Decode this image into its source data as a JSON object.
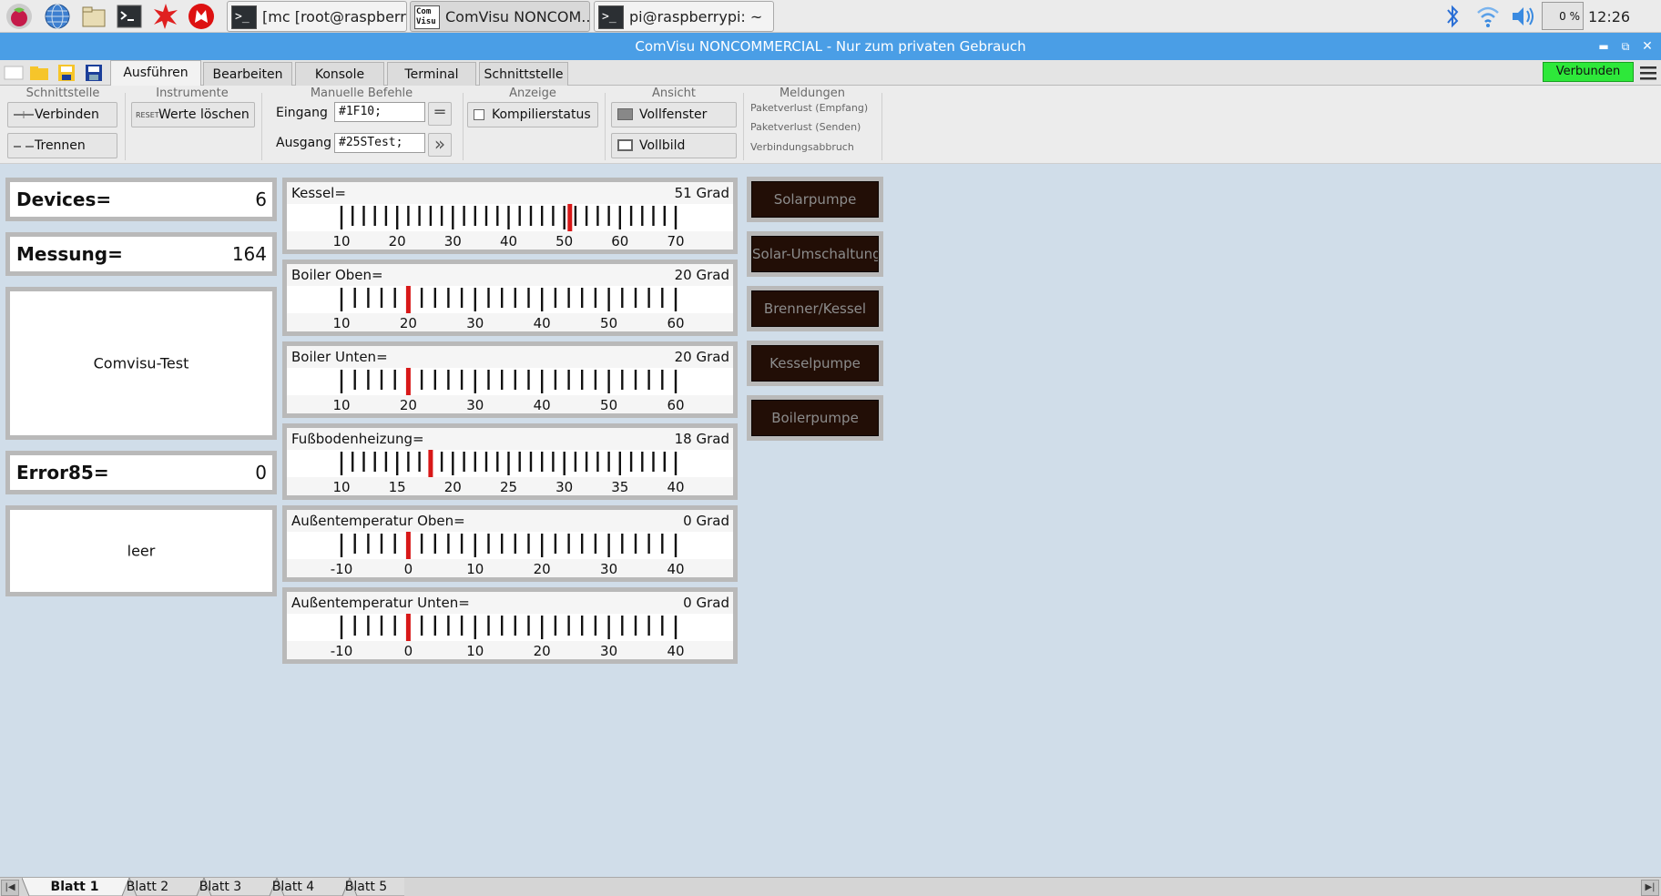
{
  "taskbar": {
    "apps": [
      {
        "label": "[mc [root@raspberry...",
        "icon": "terminal-icon"
      },
      {
        "label": "ComVisu NONCOM...",
        "icon": "comvisu-icon"
      },
      {
        "label": "pi@raspberrypi: ~",
        "icon": "terminal-icon"
      }
    ],
    "cpu": "0 %",
    "clock": "12:26"
  },
  "window": {
    "title": "ComVisu NONCOMMERCIAL - Nur zum privaten Gebrauch"
  },
  "tabs": [
    {
      "label": "Ausführen",
      "active": true
    },
    {
      "label": "Bearbeiten",
      "active": false
    },
    {
      "label": "Konsole",
      "active": false
    },
    {
      "label": "Terminal",
      "active": false
    },
    {
      "label": "Schnittstelle",
      "active": false
    }
  ],
  "status": {
    "connected": "Verbunden",
    "color": "#2ee83a"
  },
  "ribbon": {
    "schnittstelle": {
      "title": "Schnittstelle",
      "connect": "Verbinden",
      "disconnect": "Trennen"
    },
    "instrumente": {
      "title": "Instrumente",
      "reset_icon": "RESET",
      "clear": "Werte löschen"
    },
    "manuell": {
      "title": "Manuelle Befehle",
      "input_label": "Eingang",
      "input_value": "#1F10;",
      "output_label": "Ausgang",
      "output_value": "#25STest;"
    },
    "anzeige": {
      "title": "Anzeige",
      "compile_status": "Kompilierstatus"
    },
    "ansicht": {
      "title": "Ansicht",
      "window": "Vollfenster",
      "fullscreen": "Vollbild"
    },
    "meldungen": {
      "title": "Meldungen",
      "items": [
        "Paketverlust (Empfang)",
        "Paketverlust (Senden)",
        "Verbindungsabbruch"
      ]
    }
  },
  "cards": {
    "devices": {
      "label": "Devices=",
      "value": "6"
    },
    "messung": {
      "label": "Messung=",
      "value": "164"
    },
    "test": {
      "text": "Comvisu-Test"
    },
    "error": {
      "label": "Error85=",
      "value": "0"
    },
    "leer": {
      "text": "leer"
    }
  },
  "gauges": [
    {
      "name": "Kessel=",
      "value": "51 Grad",
      "current": 51,
      "min": 10,
      "max": 70,
      "ticks": [
        "10",
        "20",
        "30",
        "40",
        "50",
        "60",
        "70"
      ],
      "minor_per_major": 5
    },
    {
      "name": "Boiler Oben=",
      "value": "20 Grad",
      "current": 20,
      "min": 10,
      "max": 60,
      "ticks": [
        "10",
        "20",
        "30",
        "40",
        "50",
        "60"
      ],
      "minor_per_major": 5
    },
    {
      "name": "Boiler Unten=",
      "value": "20 Grad",
      "current": 20,
      "min": 10,
      "max": 60,
      "ticks": [
        "10",
        "20",
        "30",
        "40",
        "50",
        "60"
      ],
      "minor_per_major": 5
    },
    {
      "name": "Fußbodenheizung=",
      "value": "18 Grad",
      "current": 18,
      "min": 10,
      "max": 40,
      "ticks": [
        "10",
        "15",
        "20",
        "25",
        "30",
        "35",
        "40"
      ],
      "minor_per_major": 5
    },
    {
      "name": "Außentemperatur Oben=",
      "value": "0 Grad",
      "current": 0,
      "min": -10,
      "max": 40,
      "ticks": [
        "-10",
        "0",
        "10",
        "20",
        "30",
        "40"
      ],
      "minor_per_major": 5
    },
    {
      "name": "Außentemperatur Unten=",
      "value": "0 Grad",
      "current": 0,
      "min": -10,
      "max": 40,
      "ticks": [
        "-10",
        "0",
        "10",
        "20",
        "30",
        "40"
      ],
      "minor_per_major": 5
    }
  ],
  "buttons": [
    "Solarpumpe",
    "Solar-Umschaltung",
    "Brenner/Kessel",
    "Kesselpumpe",
    "Boilerpumpe"
  ],
  "sheets": [
    {
      "label": "Blatt 1",
      "active": true
    },
    {
      "label": "Blatt 2",
      "active": false
    },
    {
      "label": "Blatt 3",
      "active": false
    },
    {
      "label": "Blatt 4",
      "active": false
    },
    {
      "label": "Blatt 5",
      "active": false
    }
  ]
}
